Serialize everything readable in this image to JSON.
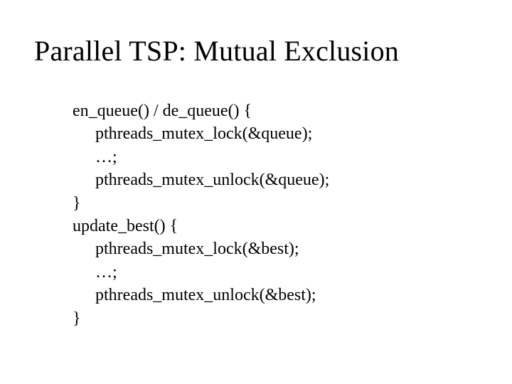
{
  "title": "Parallel TSP: Mutual Exclusion",
  "code": {
    "l0": "en_queue() / de_queue() {",
    "l1": "pthreads_mutex_lock(&queue);",
    "l2": "…;",
    "l3": "pthreads_mutex_unlock(&queue);",
    "l4": "}",
    "l5": "update_best() {",
    "l6": "pthreads_mutex_lock(&best);",
    "l7": "…;",
    "l8": "pthreads_mutex_unlock(&best);",
    "l9": "}"
  }
}
